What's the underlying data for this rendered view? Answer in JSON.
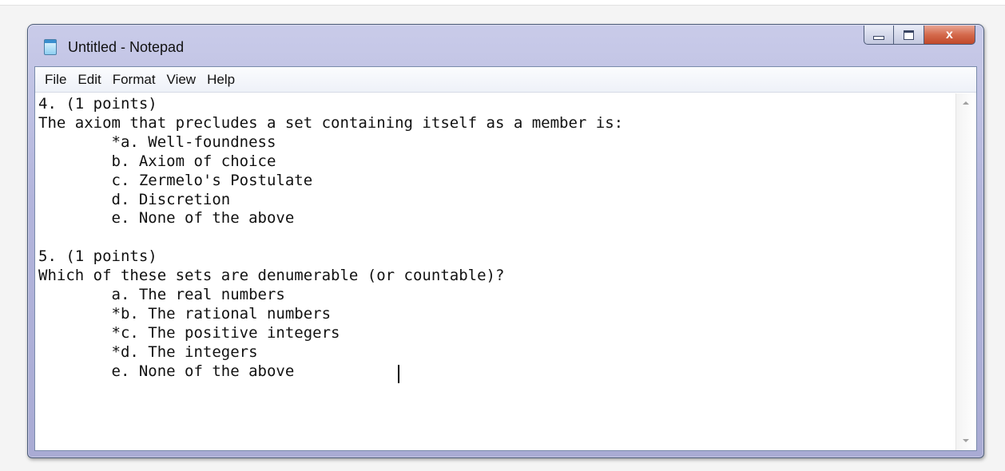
{
  "window": {
    "title": "Untitled - Notepad",
    "controls": {
      "minimize": "",
      "maximize": "",
      "close": "x"
    }
  },
  "menubar": {
    "items": [
      "File",
      "Edit",
      "Format",
      "View",
      "Help"
    ]
  },
  "editor": {
    "content": "4. (1 points)\nThe axiom that precludes a set containing itself as a member is:\n        *a. Well-foundness\n        b. Axiom of choice\n        c. Zermelo's Postulate\n        d. Discretion\n        e. None of the above\n\n5. (1 points)\nWhich of these sets are denumerable (or countable)?\n        a. The real numbers\n        *b. The rational numbers\n        *c. The positive integers\n        *d. The integers\n        e. None of the above"
  }
}
